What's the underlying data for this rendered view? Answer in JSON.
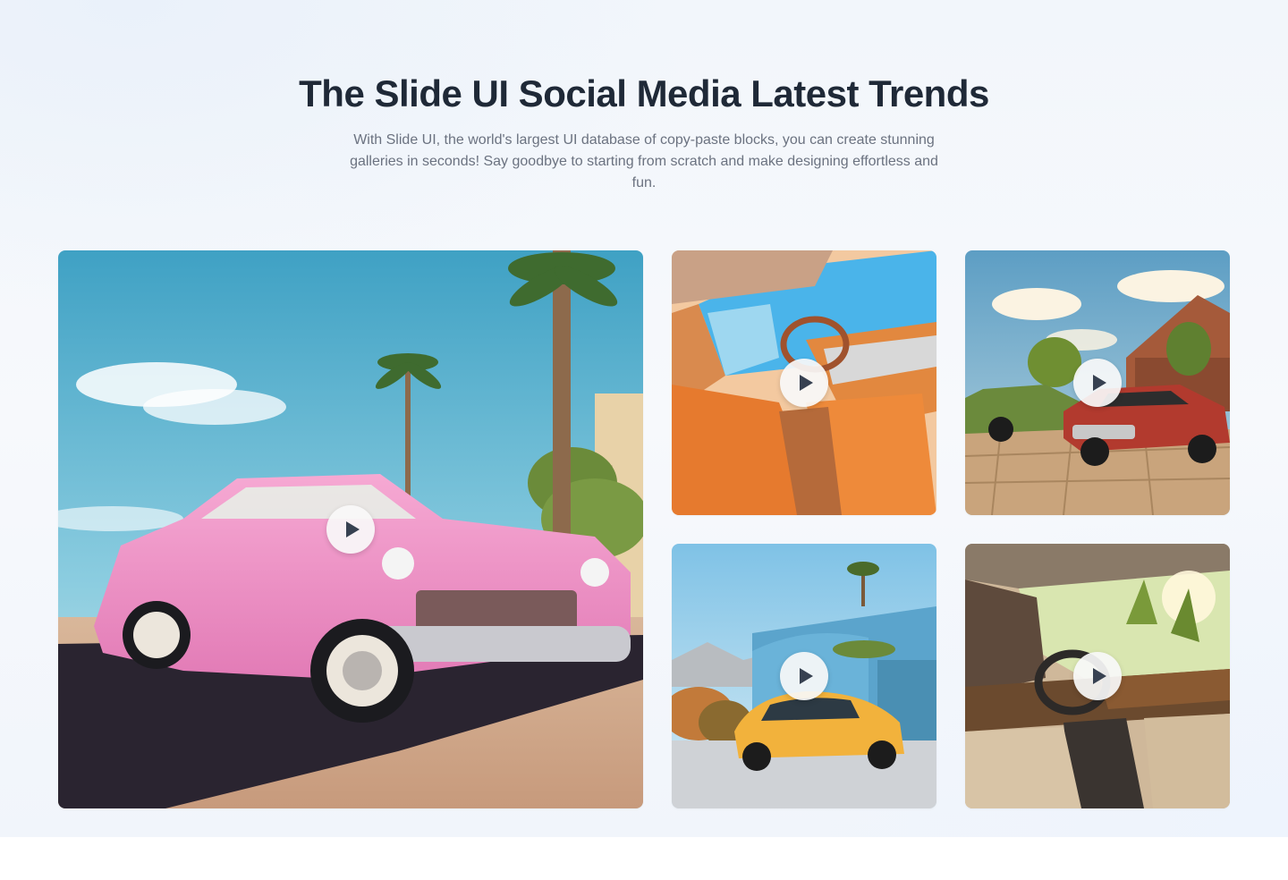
{
  "header": {
    "title": "The Slide UI Social Media Latest Trends",
    "subtitle": "With Slide UI, the world's largest UI database of copy-paste blocks, you can create stunning galleries in seconds! Say goodbye to starting from scratch and make designing effortless and fun."
  },
  "gallery": {
    "items": [
      {
        "subject": "pink-vintage-car",
        "icon": "play-icon"
      },
      {
        "subject": "orange-car-interior",
        "icon": "play-icon"
      },
      {
        "subject": "red-and-green-classic-cars",
        "icon": "play-icon"
      },
      {
        "subject": "yellow-sports-car",
        "icon": "play-icon"
      },
      {
        "subject": "beige-car-interior",
        "icon": "play-icon"
      }
    ]
  },
  "colors": {
    "title": "#1f2937",
    "subtitle": "#6b7280",
    "play_button": "#f8f8f8",
    "play_glyph": "#374151"
  }
}
